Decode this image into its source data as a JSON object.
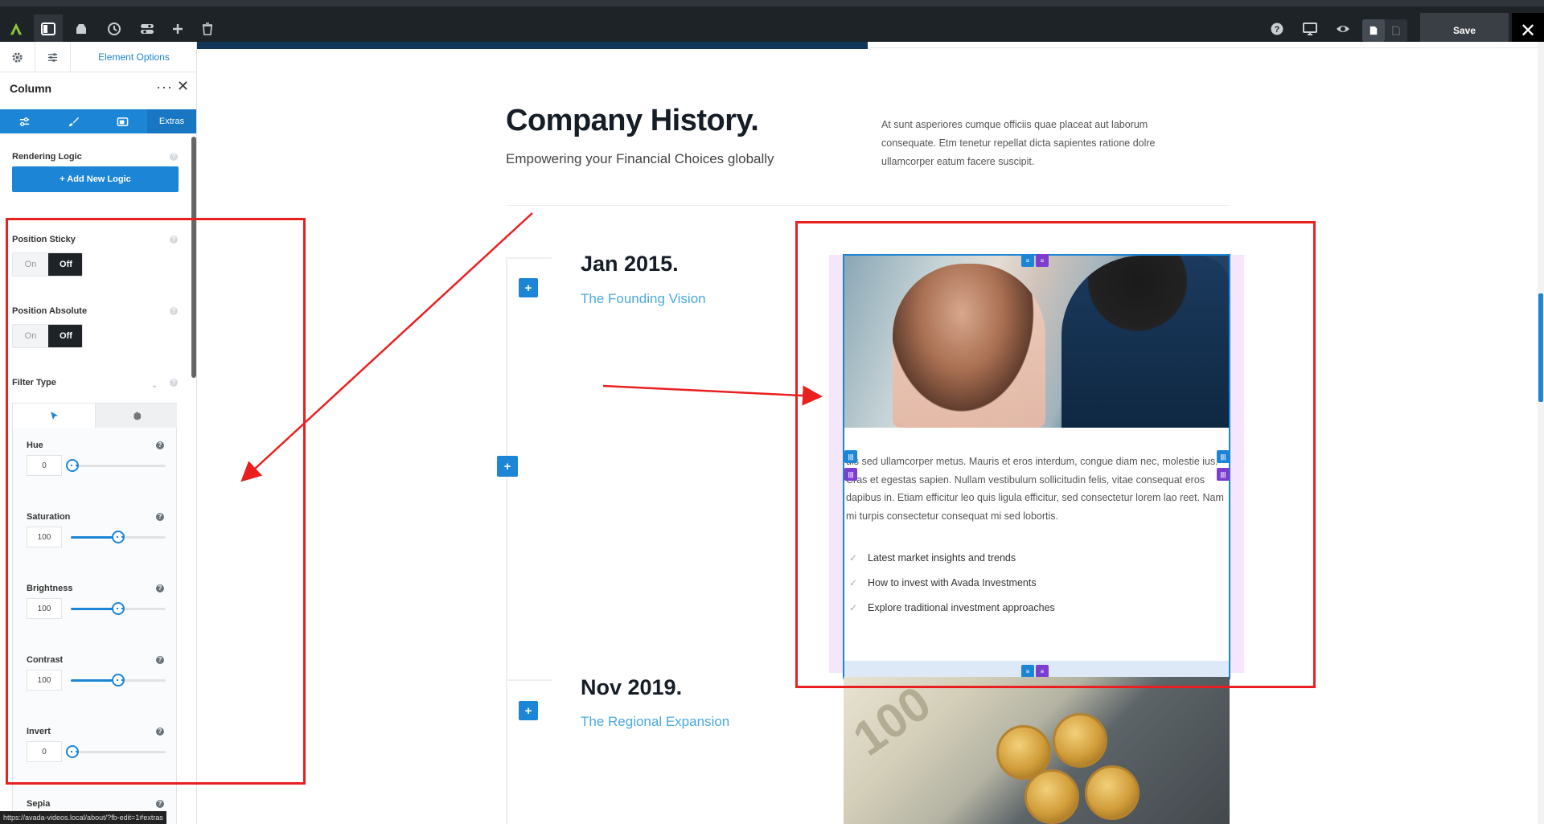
{
  "toolbar": {
    "logo": "avada-logo-icon",
    "icons": [
      "sidebar-toggle-icon",
      "library-icon",
      "history-icon",
      "toggles-icon",
      "add-icon",
      "trash-icon"
    ],
    "right_icons": [
      "help-icon",
      "desktop-icon",
      "preview-eye-icon"
    ],
    "save_label": "Save",
    "close_glyph": "✕"
  },
  "sidebar": {
    "top_tab_label": "Element Options",
    "title": "Column",
    "more_glyph": "···",
    "close_glyph": "✕",
    "subtabs": [
      {
        "icon": "general-sliders-icon",
        "label": ""
      },
      {
        "icon": "design-brush-icon",
        "label": ""
      },
      {
        "icon": "background-icon",
        "label": ""
      },
      {
        "icon": "",
        "label": "Extras"
      }
    ],
    "rendering_logic_label": "Rendering Logic",
    "add_logic_label": "+ Add New Logic",
    "position_sticky": {
      "label": "Position Sticky",
      "on": "On",
      "off": "Off",
      "value": "Off"
    },
    "position_absolute": {
      "label": "Position Absolute",
      "on": "On",
      "off": "Off",
      "value": "Off"
    },
    "filter_type_label": "Filter Type",
    "filter_tabs": [
      "cursor-pointer-icon",
      "hover-hand-icon"
    ],
    "filters": [
      {
        "label": "Hue",
        "value": "0",
        "fraction": 0.0
      },
      {
        "label": "Saturation",
        "value": "100",
        "fraction": 0.5
      },
      {
        "label": "Brightness",
        "value": "100",
        "fraction": 0.5
      },
      {
        "label": "Contrast",
        "value": "100",
        "fraction": 0.5
      },
      {
        "label": "Invert",
        "value": "0",
        "fraction": 0.0
      }
    ],
    "sepia_label": "Sepia",
    "help_glyph": "?"
  },
  "status_url": "https://avada-videos.local/about/?fb-edit=1#extras",
  "page": {
    "title": "Company History.",
    "subtitle": "Empowering your Financial Choices globally",
    "description": "At sunt asperiores cumque officiis quae placeat aut laborum consequate. Etm tenetur repellat dicta sapientes ratione dolre ullamcorper eatum facere suscipit.",
    "timeline": [
      {
        "date": "Jan 2015.",
        "subtitle": "The Founding Vision"
      },
      {
        "date": "Nov 2019.",
        "subtitle": "The Regional Expansion"
      }
    ],
    "card_text": "uis sed ullamcorper metus. Mauris et eros interdum, congue diam nec, molestie ius. Cras et egestas sapien. Nullam vestibulum sollicitudin felis, vitae consequat eros dapibus in. Etiam efficitur leo quis ligula efficitur, sed consectetur lorem lao reet. Nam mi turpis consectetur consequat mi sed lobortis.",
    "card_list": [
      "Latest market insights and trends",
      "How to invest with Avada Investments",
      "Explore traditional investment approaches"
    ],
    "coins_bill_text": "100",
    "plus_glyph": "+",
    "to_top_glyph": "⌃"
  },
  "colors": {
    "accent": "#1d85d6",
    "annotation_red": "#ea2020",
    "handle_purple": "#7b3ed1",
    "toolbar_bg": "#1d2327"
  }
}
